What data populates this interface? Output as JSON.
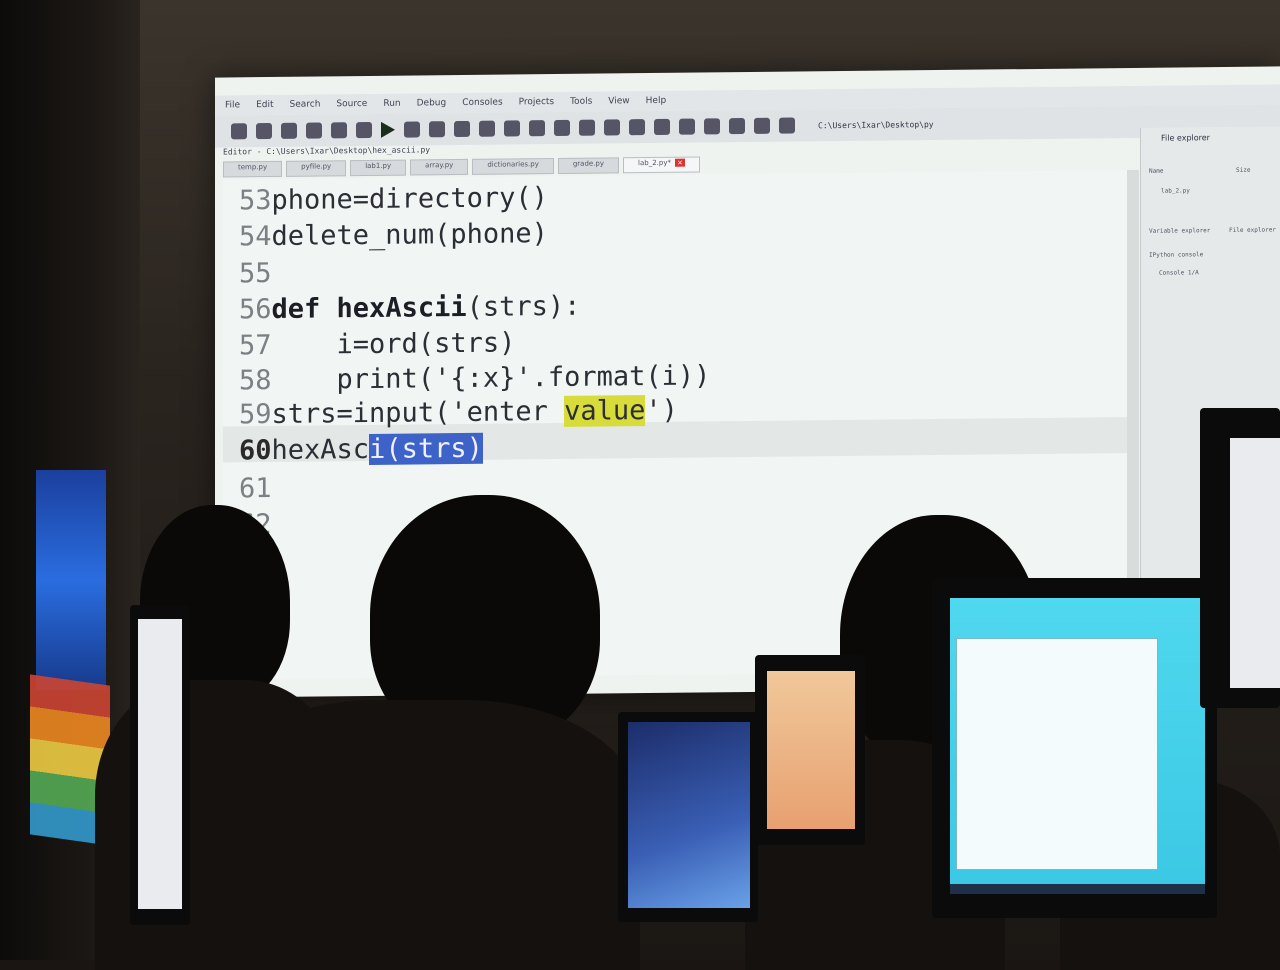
{
  "ide": {
    "menu": [
      "File",
      "Edit",
      "Search",
      "Source",
      "Run",
      "Debug",
      "Consoles",
      "Projects",
      "Tools",
      "View",
      "Help"
    ],
    "toolbar_path": "C:\\Users\\Ixar\\Desktop\\py",
    "editor_path": "Editor - C:\\Users\\Ixar\\Desktop\\hex_ascii.py",
    "tabs": [
      {
        "label": "temp.py"
      },
      {
        "label": "pyfile.py"
      },
      {
        "label": "lab1.py"
      },
      {
        "label": "array.py"
      },
      {
        "label": "dictionaries.py"
      },
      {
        "label": "grade.py"
      },
      {
        "label": "lab_2.py*",
        "active": true
      }
    ],
    "right_panel": {
      "title": "File explorer",
      "col_name": "Name",
      "col_size": "Size",
      "file": "lab_2.py",
      "tab_vars": "Variable explorer",
      "tab_files": "File explorer",
      "console_title": "IPython console",
      "console_tab": "Console 1/A"
    },
    "code_lines": [
      {
        "num": "53",
        "text": "phone=directory()"
      },
      {
        "num": "54",
        "text": "delete_num(phone)"
      },
      {
        "num": "55",
        "text": ""
      },
      {
        "num": "56",
        "kw": "def ",
        "fn": "hexAscii",
        "rest": "(strs):"
      },
      {
        "num": "57",
        "text": "    i=ord(strs)"
      },
      {
        "num": "58",
        "text": "    print('{:x}'.format(i))"
      },
      {
        "num": "59",
        "pre": "strs=input('enter ",
        "hl": "value",
        "post": "')"
      },
      {
        "num": "60",
        "pre": "hexAsc",
        "sel": "i(strs)",
        "current": true
      },
      {
        "num": "61",
        "text": ""
      },
      {
        "num": "62",
        "text": ""
      }
    ]
  }
}
